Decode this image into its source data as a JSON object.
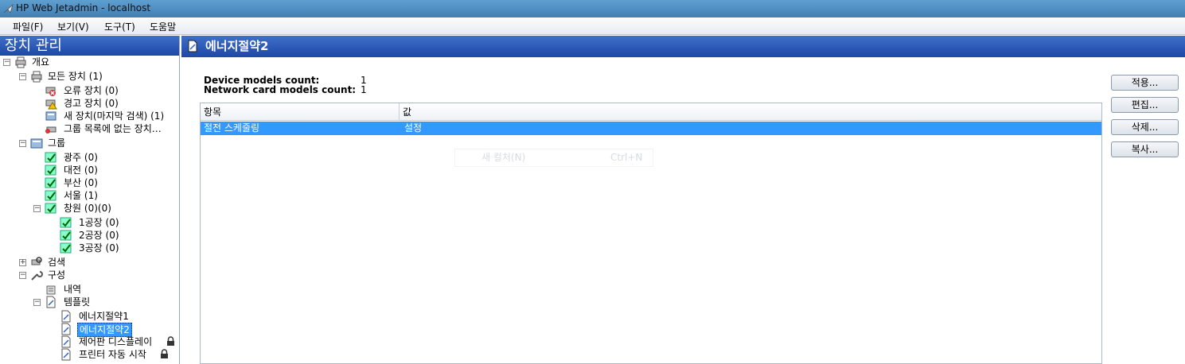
{
  "window": {
    "title": "HP Web Jetadmin - localhost"
  },
  "menu": [
    "파일(F)",
    "보기(V)",
    "도구(T)",
    "도움말"
  ],
  "left_panel": {
    "title": "장치 관리",
    "tree": {
      "overview": "개요",
      "all_devices": "모든 장치 (1)",
      "error_devices": "오류 장치 (0)",
      "warning_devices": "경고 장치 (0)",
      "new_devices": "새 장치(마지막 검색) (1)",
      "ungrouped_devices": "그룹 목록에 없는 장치…",
      "groups": "그룹",
      "gwangju": "광주 (0)",
      "daejeon": "대전 (0)",
      "busan": "부산 (0)",
      "seoul": "서울 (1)",
      "changwon": "창원 (0)(0)",
      "factory1": "1공장 (0)",
      "factory2": "2공장 (0)",
      "factory3": "3공장 (0)",
      "search": "검색",
      "config": "구성",
      "history": "내역",
      "templates": "템플릿",
      "template1": "에너지절약1",
      "template2": "에너지절약2",
      "template3": "제어판 디스플레이",
      "template4": "프린터 자동 시작"
    }
  },
  "main": {
    "title": "에너지절약2",
    "stats": {
      "device_models_label": "Device models count:",
      "device_models_value": "1",
      "network_card_label": "Network card models count:",
      "network_card_value": "1"
    },
    "grid": {
      "columns": [
        "항목",
        "값"
      ],
      "rows": [
        {
          "item": "절전 스케줄링",
          "value": "설정"
        }
      ]
    },
    "ghost_menu": {
      "label": "새 컬처(N)",
      "shortcut": "Ctrl+N"
    },
    "buttons": {
      "apply": "적용...",
      "edit": "편집...",
      "delete": "삭제...",
      "copy": "복사..."
    }
  },
  "colors": {
    "accent": "#1e48a6",
    "selection": "#3399ff"
  }
}
